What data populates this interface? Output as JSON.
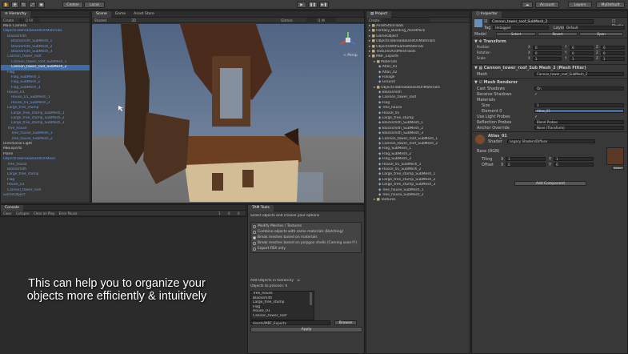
{
  "toolbar": {
    "center_label": "Center",
    "local_label": "Local",
    "account_label": "Account",
    "layers_label": "Layers",
    "layout_label": "MyDefault"
  },
  "hierarchy": {
    "tab": "Hierarchy",
    "create_label": "Create",
    "search_placeholder": "Q All",
    "items": [
      {
        "label": "Main Camera",
        "indent": 0,
        "color": "normal",
        "selected": false
      },
      {
        "label": "ObjectsToBreakBasedOnMaterials",
        "indent": 0,
        "color": "blue",
        "selected": false
      },
      {
        "label": "Blacksmith",
        "indent": 1,
        "color": "blue",
        "selected": false
      },
      {
        "label": "Blacksmith_SubMesh_1",
        "indent": 2,
        "color": "blue",
        "selected": false
      },
      {
        "label": "Blacksmith_SubMesh_2",
        "indent": 2,
        "color": "blue",
        "selected": false
      },
      {
        "label": "Blacksmith_SubMesh_3",
        "indent": 2,
        "color": "blue",
        "selected": false
      },
      {
        "label": "Cannon_tower_roof",
        "indent": 1,
        "color": "blue",
        "selected": false
      },
      {
        "label": "Cannon_tower_roof_SubMesh_1",
        "indent": 2,
        "color": "blue",
        "selected": false
      },
      {
        "label": "Cannon_tower_roof_SubMesh_2",
        "indent": 2,
        "color": "blue",
        "selected": true
      },
      {
        "label": "Flag",
        "indent": 1,
        "color": "blue",
        "selected": false
      },
      {
        "label": "Flag_SubMesh_1",
        "indent": 2,
        "color": "blue",
        "selected": false
      },
      {
        "label": "Flag_SubMesh_2",
        "indent": 2,
        "color": "blue",
        "selected": false
      },
      {
        "label": "Flag_SubMesh_3",
        "indent": 2,
        "color": "blue",
        "selected": false
      },
      {
        "label": "House_01",
        "indent": 1,
        "color": "blue",
        "selected": false
      },
      {
        "label": "House_01_SubMesh_1",
        "indent": 2,
        "color": "blue",
        "selected": false
      },
      {
        "label": "House_01_SubMesh_2",
        "indent": 2,
        "color": "blue",
        "selected": false
      },
      {
        "label": "Large_tree_stump",
        "indent": 1,
        "color": "blue",
        "selected": false
      },
      {
        "label": "Large_tree_stump_SubMesh_1",
        "indent": 2,
        "color": "blue",
        "selected": false
      },
      {
        "label": "Large_tree_stump_SubMesh_2",
        "indent": 2,
        "color": "blue",
        "selected": false
      },
      {
        "label": "Large_tree_stump_SubMesh_3",
        "indent": 2,
        "color": "blue",
        "selected": false
      },
      {
        "label": "Tree_house",
        "indent": 1,
        "color": "blue",
        "selected": false
      },
      {
        "label": "Tree_house_SubMesh_1",
        "indent": 2,
        "color": "blue",
        "selected": false
      },
      {
        "label": "Tree_house_SubMesh_2",
        "indent": 2,
        "color": "blue",
        "selected": false
      },
      {
        "label": "Directional Light",
        "indent": 0,
        "color": "normal",
        "selected": false
      },
      {
        "label": "MBExports",
        "indent": 0,
        "color": "normal",
        "selected": false
      },
      {
        "label": "Plane",
        "indent": 0,
        "color": "normal",
        "selected": false
      },
      {
        "label": "ObjectsToBreakBasedOnMesh",
        "indent": 0,
        "color": "blue",
        "selected": false
      },
      {
        "label": "Tree_house",
        "indent": 1,
        "color": "blue",
        "selected": false
      },
      {
        "label": "Blacksmith",
        "indent": 1,
        "color": "blue",
        "selected": false
      },
      {
        "label": "Large_tree_stump",
        "indent": 1,
        "color": "blue",
        "selected": false
      },
      {
        "label": "Flag",
        "indent": 1,
        "color": "blue",
        "selected": false
      },
      {
        "label": "House_01",
        "indent": 1,
        "color": "blue",
        "selected": false
      },
      {
        "label": "Cannon_tower_roof",
        "indent": 1,
        "color": "blue",
        "selected": false
      },
      {
        "label": "GameObject",
        "indent": 0,
        "color": "blue",
        "selected": false
      }
    ]
  },
  "scene": {
    "tabs": [
      "Scene",
      "Game",
      "Asset Store"
    ],
    "shaded_label": "Shaded",
    "mode_2d": "2D",
    "gizmos_label": "Gizmos",
    "search_placeholder": "Q All",
    "persp_label": "< Persp"
  },
  "console": {
    "tab": "Console",
    "buttons": [
      "Clear",
      "Collapse",
      "Clear on Play",
      "Error Pause"
    ],
    "counts": [
      "1",
      "0",
      "0"
    ]
  },
  "caption": {
    "line1": "This can help you to organize your",
    "line2": "objects more efficiently & intuitively"
  },
  "tools_panel": {
    "tab": "TAM Tools",
    "instruction": "Select objects and choose your options",
    "options": [
      {
        "label": "Modify Meshes / Textures",
        "selected": false
      },
      {
        "label": "Combine objects with same materials (Batching)",
        "selected": false
      },
      {
        "label": "Break meshes based on materials",
        "selected": true
      },
      {
        "label": "Break meshes based on polygon shells (Coming soon!!!)",
        "selected": false
      },
      {
        "label": "Export FBX only",
        "selected": false
      }
    ],
    "add_in_hierarchy_label": "Add Objects in hierarchy",
    "objects_to_process_label": "Objects to process: 6",
    "objects": [
      "Tree_house",
      "Blacksmith",
      "Large_tree_stump",
      "Flag",
      "House_01",
      "Cannon_tower_roof"
    ],
    "path_value": "Assets/MBF_Exports",
    "browse_label": "Browse",
    "apply_label": "Apply"
  },
  "project": {
    "tab": "Project",
    "create_label": "Create",
    "items": [
      {
        "label": "AssetStoreTools",
        "indent": 0,
        "type": "folder"
      },
      {
        "label": "Fantasy_Building_AssetPack",
        "indent": 0,
        "type": "folder"
      },
      {
        "label": "GameObject",
        "indent": 0,
        "type": "folder"
      },
      {
        "label": "ObjectsToBreakBasedOnMaterials",
        "indent": 0,
        "type": "folder"
      },
      {
        "label": "ObjectsWithSameMaterials",
        "indent": 0,
        "type": "folder"
      },
      {
        "label": "TexturesAndMeshTools",
        "indent": 0,
        "type": "folder"
      },
      {
        "label": "MBF_Exports",
        "indent": 0,
        "type": "folder"
      },
      {
        "label": "Materials",
        "indent": 1,
        "type": "folder"
      },
      {
        "label": "Atlas_01",
        "indent": 2,
        "type": "asset"
      },
      {
        "label": "Atlas_02",
        "indent": 2,
        "type": "asset"
      },
      {
        "label": "Foliage",
        "indent": 2,
        "type": "asset"
      },
      {
        "label": "Ground",
        "indent": 2,
        "type": "asset"
      },
      {
        "label": "ObjectsToBreakBasedOnMaterials",
        "indent": 1,
        "type": "folder"
      },
      {
        "label": "Blacksmith",
        "indent": 2,
        "type": "asset"
      },
      {
        "label": "Cannon_tower_roof",
        "indent": 2,
        "type": "asset"
      },
      {
        "label": "Flag",
        "indent": 2,
        "type": "asset"
      },
      {
        "label": "Tree_house",
        "indent": 2,
        "type": "asset"
      },
      {
        "label": "House_01",
        "indent": 2,
        "type": "asset"
      },
      {
        "label": "Large_tree_stump",
        "indent": 2,
        "type": "asset"
      },
      {
        "label": "Blacksmith_SubMesh_1",
        "indent": 2,
        "type": "asset"
      },
      {
        "label": "Blacksmith_SubMesh_2",
        "indent": 2,
        "type": "asset"
      },
      {
        "label": "Blacksmith_SubMesh_3",
        "indent": 2,
        "type": "asset"
      },
      {
        "label": "Cannon_tower_roof_SubMesh_1",
        "indent": 2,
        "type": "asset"
      },
      {
        "label": "Cannon_tower_roof_SubMesh_2",
        "indent": 2,
        "type": "asset"
      },
      {
        "label": "Flag_SubMesh_1",
        "indent": 2,
        "type": "asset"
      },
      {
        "label": "Flag_SubMesh_2",
        "indent": 2,
        "type": "asset"
      },
      {
        "label": "Flag_SubMesh_3",
        "indent": 2,
        "type": "asset"
      },
      {
        "label": "House_01_SubMesh_1",
        "indent": 2,
        "type": "asset"
      },
      {
        "label": "House_01_SubMesh_2",
        "indent": 2,
        "type": "asset"
      },
      {
        "label": "Large_tree_stump_SubMesh_1",
        "indent": 2,
        "type": "asset"
      },
      {
        "label": "Large_tree_stump_SubMesh_2",
        "indent": 2,
        "type": "asset"
      },
      {
        "label": "Large_tree_stump_SubMesh_3",
        "indent": 2,
        "type": "asset"
      },
      {
        "label": "Tree_house_SubMesh_1",
        "indent": 2,
        "type": "asset"
      },
      {
        "label": "Tree_house_SubMesh_2",
        "indent": 2,
        "type": "asset"
      },
      {
        "label": "Textures",
        "indent": 1,
        "type": "folder"
      }
    ]
  },
  "inspector": {
    "tab": "Inspector",
    "object_name": "Cannon_tower_roof_SubMesh_2",
    "static_label": "Static",
    "tag_label": "Tag",
    "tag_value": "Untagged",
    "layer_label": "Layer",
    "layer_value": "Default",
    "model_label": "Model",
    "model_buttons": [
      "Select",
      "Revert",
      "Open"
    ],
    "transform": {
      "title": "Transform",
      "rows": [
        {
          "label": "Position",
          "x": "0",
          "y": "0",
          "z": "0"
        },
        {
          "label": "Rotation",
          "x": "0",
          "y": "0",
          "z": "0"
        },
        {
          "label": "Scale",
          "x": "1",
          "y": "1",
          "z": "1"
        }
      ]
    },
    "mesh_filter": {
      "title": "Cannon_tower_roof_Sub Mesh_2 (Mesh Filter)",
      "mesh_label": "Mesh",
      "mesh_value": "Cannon_tower_roof_SubMesh_2"
    },
    "mesh_renderer": {
      "title": "Mesh Renderer",
      "rows": [
        {
          "label": "Cast Shadows",
          "value": "On"
        },
        {
          "label": "Receive Shadows",
          "value": "✓"
        },
        {
          "label": "Materials",
          "value": ""
        },
        {
          "label": "Size",
          "value": "1"
        },
        {
          "label": "Element 0",
          "value": "Atlas_01"
        },
        {
          "label": "Use Light Probes",
          "value": "✓"
        },
        {
          "label": "Reflection Probes",
          "value": "Blend Probes"
        },
        {
          "label": "Anchor Override",
          "value": "None (Transform)"
        }
      ]
    },
    "material": {
      "name": "Atlas_01",
      "shader_label": "Shader",
      "shader_value": "Legacy Shaders/Diffuse",
      "base_label": "Base (RGB)",
      "tiling_label": "Tiling",
      "offset_label": "Offset",
      "tiling": {
        "x": "1",
        "y": "1"
      },
      "offset": {
        "x": "0",
        "y": "0"
      },
      "select_label": "Select"
    },
    "add_component_label": "Add Component"
  },
  "colors": {
    "accent_blue": "#3d6ca8",
    "prefab_blue": "#6f9cdc",
    "sky_top": "#536886",
    "ground": "#787878"
  }
}
